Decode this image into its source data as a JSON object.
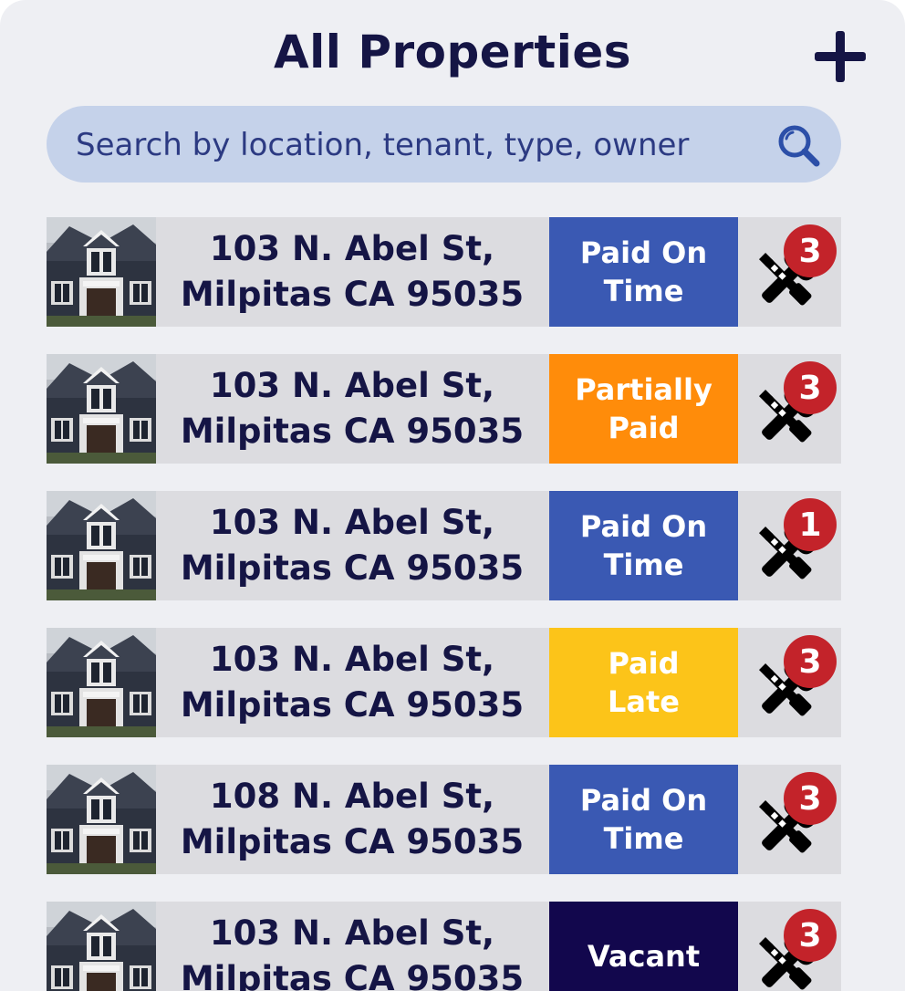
{
  "header": {
    "title": "All Properties",
    "add_icon": "plus-icon"
  },
  "search": {
    "placeholder": "Search by location, tenant, type, owner",
    "icon": "search-icon"
  },
  "status_colors": {
    "Paid On Time": "#3a59b3",
    "Partially Paid": "#ff8c0a",
    "Paid Late": "#fcc419",
    "Vacant": "#12074d"
  },
  "properties": [
    {
      "address_line1": "103 N. Abel St,",
      "address_line2": "Milpitas CA 95035",
      "status": "Paid On Time",
      "maintenance_count": "3"
    },
    {
      "address_line1": "103 N. Abel St,",
      "address_line2": "Milpitas CA 95035",
      "status": "Partially Paid",
      "maintenance_count": "3"
    },
    {
      "address_line1": "103 N. Abel St,",
      "address_line2": "Milpitas CA 95035",
      "status": "Paid On Time",
      "maintenance_count": "1"
    },
    {
      "address_line1": "103 N. Abel St,",
      "address_line2": "Milpitas CA 95035",
      "status": "Paid Late",
      "maintenance_count": "3"
    },
    {
      "address_line1": "108 N. Abel St,",
      "address_line2": "Milpitas CA 95035",
      "status": "Paid On Time",
      "maintenance_count": "3"
    },
    {
      "address_line1": "103 N. Abel St,",
      "address_line2": "Milpitas CA 95035",
      "status": "Vacant",
      "maintenance_count": "3"
    }
  ]
}
